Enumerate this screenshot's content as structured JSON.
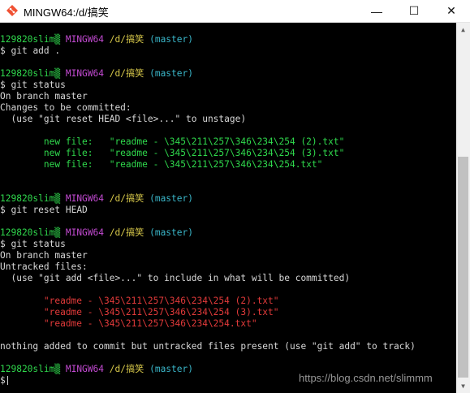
{
  "window": {
    "title": "MINGW64:/d/搞笑",
    "minimize_glyph": "—",
    "maximize_glyph": "☐",
    "close_glyph": "✕",
    "app_icon": "git-bash-icon"
  },
  "prompt": {
    "user_host": "129820slim▒",
    "shell": "MINGW64",
    "path": "/d/搞笑",
    "branch": "(master)",
    "symbol": "$"
  },
  "colors": {
    "background": "#000000",
    "green": "#2fd84c",
    "magenta": "#c24ad1",
    "yellow": "#d7c84a",
    "cyan": "#3ab6c9",
    "red": "#e23a3a",
    "text": "#d7d7d7"
  },
  "terminal": {
    "cmd1": "git add .",
    "cmd2": "git status",
    "status1": {
      "l1": "On branch master",
      "l2": "Changes to be committed:",
      "l3": "  (use \"git reset HEAD <file>...\" to unstage)",
      "files": [
        "        new file:   \"readme - \\345\\211\\257\\346\\234\\254 (2).txt\"",
        "        new file:   \"readme - \\345\\211\\257\\346\\234\\254 (3).txt\"",
        "        new file:   \"readme - \\345\\211\\257\\346\\234\\254.txt\""
      ]
    },
    "cmd3": "git reset HEAD",
    "cmd4": "git status",
    "status2": {
      "l1": "On branch master",
      "l2": "Untracked files:",
      "l3": "  (use \"git add <file>...\" to include in what will be committed)",
      "files": [
        "        \"readme - \\345\\211\\257\\346\\234\\254 (2).txt\"",
        "        \"readme - \\345\\211\\257\\346\\234\\254 (3).txt\"",
        "        \"readme - \\345\\211\\257\\346\\234\\254.txt\""
      ],
      "summary": "nothing added to commit but untracked files present (use \"git add\" to track)"
    }
  },
  "watermark": "https://blog.csdn.net/slimmm"
}
